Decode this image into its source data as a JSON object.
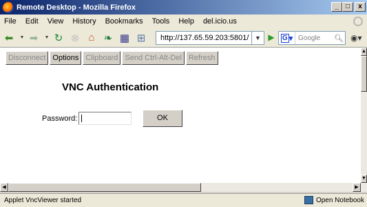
{
  "window": {
    "title": "Remote Desktop - Mozilla Firefox",
    "controls": {
      "minimize": "_",
      "maximize": "□",
      "close": "x"
    }
  },
  "menu": [
    "File",
    "Edit",
    "View",
    "History",
    "Bookmarks",
    "Tools",
    "Help",
    "del.icio.us"
  ],
  "navbar": {
    "url": "http://137.65.59.203:5801/",
    "search_placeholder": "Google",
    "search_engine_badge": "G"
  },
  "vnc_toolbar": [
    {
      "label": "Disconnect",
      "enabled": false
    },
    {
      "label": "Options",
      "enabled": true
    },
    {
      "label": "Clipboard",
      "enabled": false
    },
    {
      "label": "Send Ctrl-Alt-Del",
      "enabled": false
    },
    {
      "label": "Refresh",
      "enabled": false
    }
  ],
  "auth": {
    "title": "VNC Authentication",
    "password_label": "Password:",
    "password_value": "",
    "ok_label": "OK"
  },
  "status": {
    "text": "Applet VncViewer started",
    "notebook_label": "Open Notebook"
  }
}
